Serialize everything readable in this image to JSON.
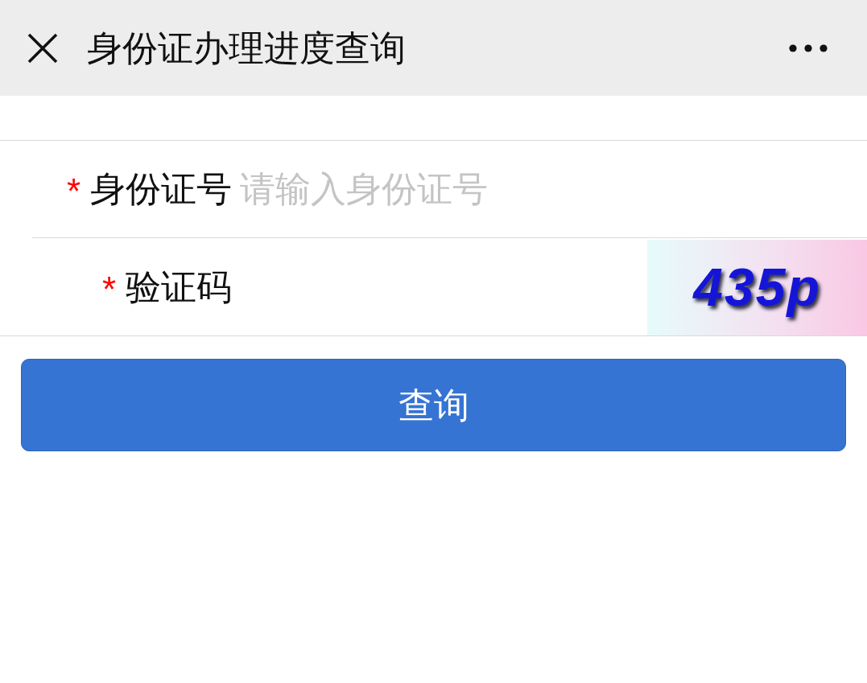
{
  "header": {
    "title": "身份证办理进度查询"
  },
  "fields": [
    {
      "kind": "text",
      "marker": "*",
      "label": "身份证号",
      "placeholder": "请输入身份证号"
    },
    {
      "kind": "captcha",
      "marker": "*",
      "label": "验证码",
      "captcha_text": "435p"
    }
  ],
  "button": {
    "label": "查询"
  }
}
